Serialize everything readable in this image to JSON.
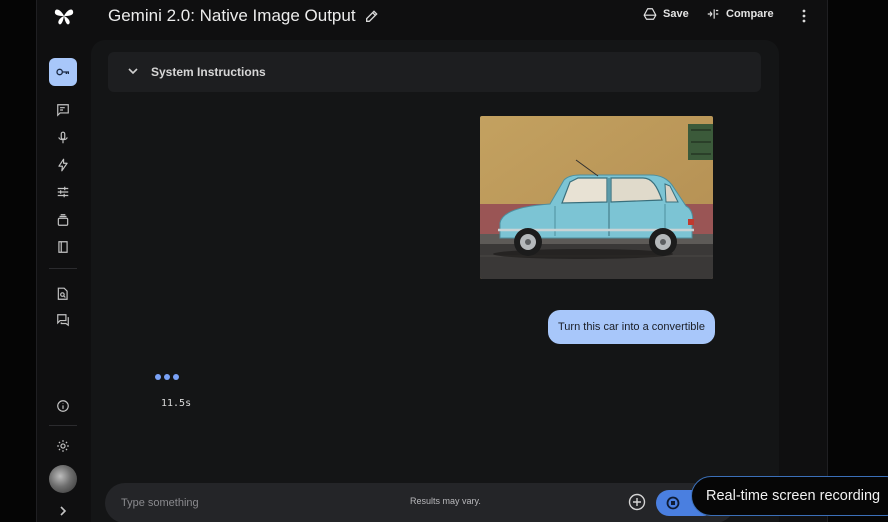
{
  "app": {
    "title": "Gemini 2.0: Native Image Output"
  },
  "toolbar": {
    "save_label": "Save",
    "compare_label": "Compare",
    "more_icon": "more-vert-icon"
  },
  "sidebar": {
    "items": [
      {
        "icon": "key-icon",
        "active": true
      },
      {
        "icon": "chat-prompt-icon"
      },
      {
        "icon": "microphone-icon"
      },
      {
        "icon": "bolt-icon"
      },
      {
        "icon": "tune-icon"
      },
      {
        "icon": "gallery-icon"
      },
      {
        "icon": "docs-book-icon"
      },
      {
        "icon": "search-doc-icon"
      },
      {
        "icon": "forum-icon"
      },
      {
        "icon": "info-icon"
      },
      {
        "icon": "settings-icon"
      }
    ]
  },
  "system_instructions": {
    "label": "System Instructions"
  },
  "chat": {
    "user_message": "Turn this car into a convertible",
    "elapsed": "11.5s"
  },
  "input": {
    "placeholder": "Type something",
    "disclaimer": "Results may vary."
  },
  "toast": {
    "text": "Real-time screen recording"
  },
  "colors": {
    "accent": "#a8c7fa",
    "run_button": "#4a7fe0",
    "background": "#0f0f10",
    "panel": "#141516"
  }
}
